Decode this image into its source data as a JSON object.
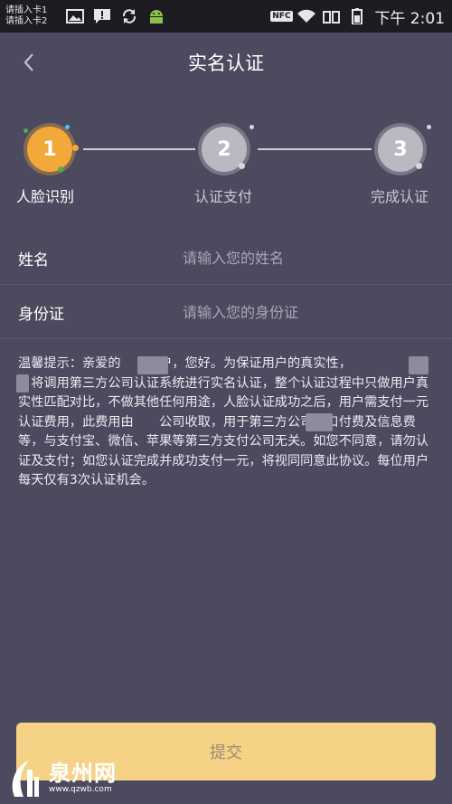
{
  "status_bar": {
    "sim1": "请插入卡1",
    "sim2": "请插入卡2",
    "nfc": "NFC",
    "time": "下午 2:01"
  },
  "header": {
    "title": "实名认证"
  },
  "steps": [
    {
      "number": "1",
      "label": "人脸识别",
      "active": true
    },
    {
      "number": "2",
      "label": "认证支付",
      "active": false
    },
    {
      "number": "3",
      "label": "完成认证",
      "active": false
    }
  ],
  "form": {
    "name_label": "姓名",
    "name_placeholder": "请输入您的姓名",
    "id_label": "身份证",
    "id_placeholder": "请输入您的身份证"
  },
  "notice": "温馨提示：亲爱的　　用户，您好。为保证用户的真实性，　\n　将调用第三方公司认证系统进行实名认证，整个认证过程中只做用户真实性匹配对比，不做其他任何用途，人脸认证成功之后，用户需支付一元认证费用，此费用由　　公司收取，用于第三方公司接口付费及信息费等，与支付宝、微信、苹果等第三方支付公司无关。如您不同意，请勿认证及支付；如您认证完成并成功支付一元，将视同同意此协议。每位用户每天仅有3次认证机会。",
  "submit_label": "提交",
  "watermark": {
    "name": "泉州网",
    "url": "www.qzwb.com"
  },
  "colors": {
    "accent": "#f3a93a",
    "background": "#4b4a5e",
    "button": "#f5d286"
  }
}
